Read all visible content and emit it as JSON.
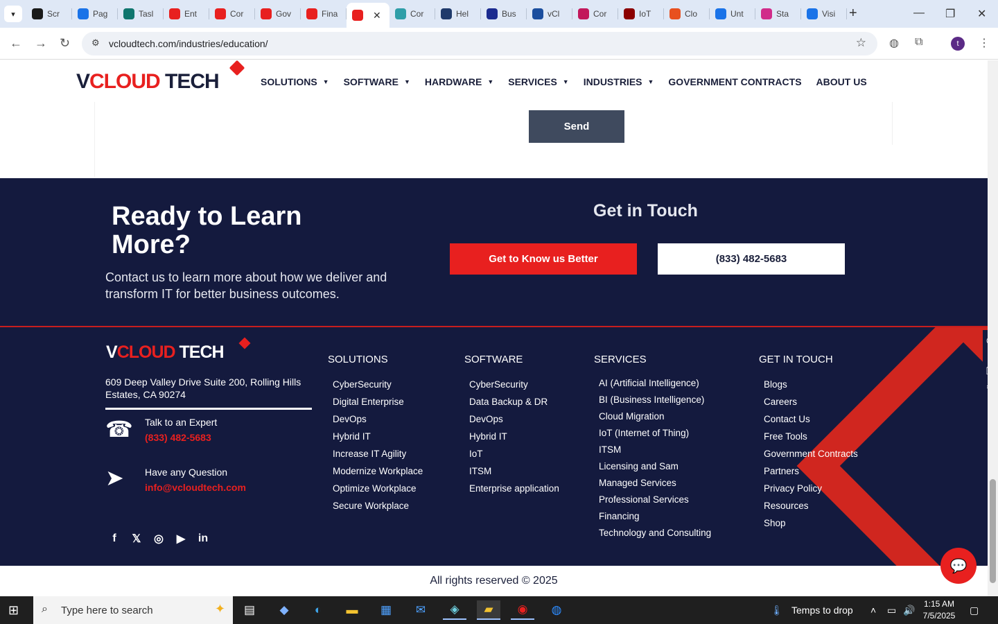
{
  "browser": {
    "tabs": [
      {
        "label": "Scr",
        "color": "#1a1a1a"
      },
      {
        "label": "Pag",
        "color": "#1a73e8"
      },
      {
        "label": "Tasl",
        "color": "#0f766e"
      },
      {
        "label": "Ent",
        "color": "#e8201f"
      },
      {
        "label": "Cor",
        "color": "#e8201f"
      },
      {
        "label": "Gov",
        "color": "#e8201f"
      },
      {
        "label": "Fina",
        "color": "#e8201f"
      },
      {
        "label": "",
        "color": "#e8201f",
        "active": true
      },
      {
        "label": "Cor",
        "color": "#2f9ea8"
      },
      {
        "label": "Hel",
        "color": "#1f3a6b"
      },
      {
        "label": "Bus",
        "color": "#1b2b8f"
      },
      {
        "label": "vCl",
        "color": "#1b4e9e"
      },
      {
        "label": "Cor",
        "color": "#c2185b"
      },
      {
        "label": "IoT",
        "color": "#8b0000"
      },
      {
        "label": "Clo",
        "color": "#e8501f"
      },
      {
        "label": "Unt",
        "color": "#1a73e8"
      },
      {
        "label": "Sta",
        "color": "#d12b8a"
      },
      {
        "label": "Visi",
        "color": "#1a73e8"
      }
    ],
    "url": "vcloudtech.com/industries/education/",
    "profile_initial": "t"
  },
  "site": {
    "logo": {
      "v": "V",
      "cloud": "CLOUD",
      "tech": " TECH"
    },
    "menu": [
      {
        "label": "SOLUTIONS",
        "caret": true
      },
      {
        "label": "SOFTWARE",
        "caret": true
      },
      {
        "label": "HARDWARE",
        "caret": true
      },
      {
        "label": "SERVICES",
        "caret": true
      },
      {
        "label": "INDUSTRIES",
        "caret": true
      },
      {
        "label": "GOVERNMENT CONTRACTS",
        "caret": false
      },
      {
        "label": "ABOUT US",
        "caret": false
      }
    ],
    "send_label": "Send"
  },
  "cta": {
    "title": "Ready to Learn More?",
    "subtitle": "Contact us to learn more about how we deliver and transform IT for better business outcomes.",
    "get_in_touch": "Get in Touch",
    "primary_button": "Get to Know us Better",
    "phone_button": "(833) 482-5683"
  },
  "footer": {
    "address": "609 Deep Valley Drive Suite 200, Rolling Hills Estates, CA 90274",
    "talk_label": "Talk to an Expert",
    "talk_phone": "(833) 482-5683",
    "question_label": "Have any Question",
    "question_email": "info@vcloudtech.com",
    "socials": [
      "facebook-icon",
      "x-icon",
      "instagram-icon",
      "youtube-icon",
      "linkedin-icon"
    ],
    "columns": {
      "solutions": {
        "title": "SOLUTIONS",
        "items": [
          "CyberSecurity",
          "Digital Enterprise",
          "DevOps",
          "Hybrid IT",
          "Increase IT Agility",
          "Modernize Workplace",
          "Optimize Workplace",
          "Secure Workplace"
        ]
      },
      "software": {
        "title": "SOFTWARE",
        "items": [
          "CyberSecurity",
          "Data Backup & DR",
          "DevOps",
          "Hybrid IT",
          "IoT",
          "ITSM",
          "Enterprise application"
        ]
      },
      "services": {
        "title": "SERVICES",
        "items": [
          "AI (Artificial Intelligence)",
          "BI (Business Intelligence)",
          "Cloud Migration",
          "IoT (Internet of Thing)",
          "ITSM",
          "Licensing and Sam",
          "Managed Services",
          "Professional Services",
          "Financing",
          "Technology and Consulting"
        ]
      },
      "get_in_touch": {
        "title": "GET IN TOUCH",
        "items": [
          "Blogs",
          "Careers",
          "Contact Us",
          "Free Tools",
          "Government Contracts",
          "Partners",
          "Privacy Policy",
          "Resources",
          "Shop"
        ]
      }
    },
    "copyright": "All rights reserved © 2025"
  },
  "taskbar": {
    "search_placeholder": "Type here to search",
    "weather": "Temps to drop",
    "time": "1:15 AM",
    "date": "7/5/2025"
  },
  "colors": {
    "brand_red": "#e8201f",
    "navy": "#141a3e"
  }
}
